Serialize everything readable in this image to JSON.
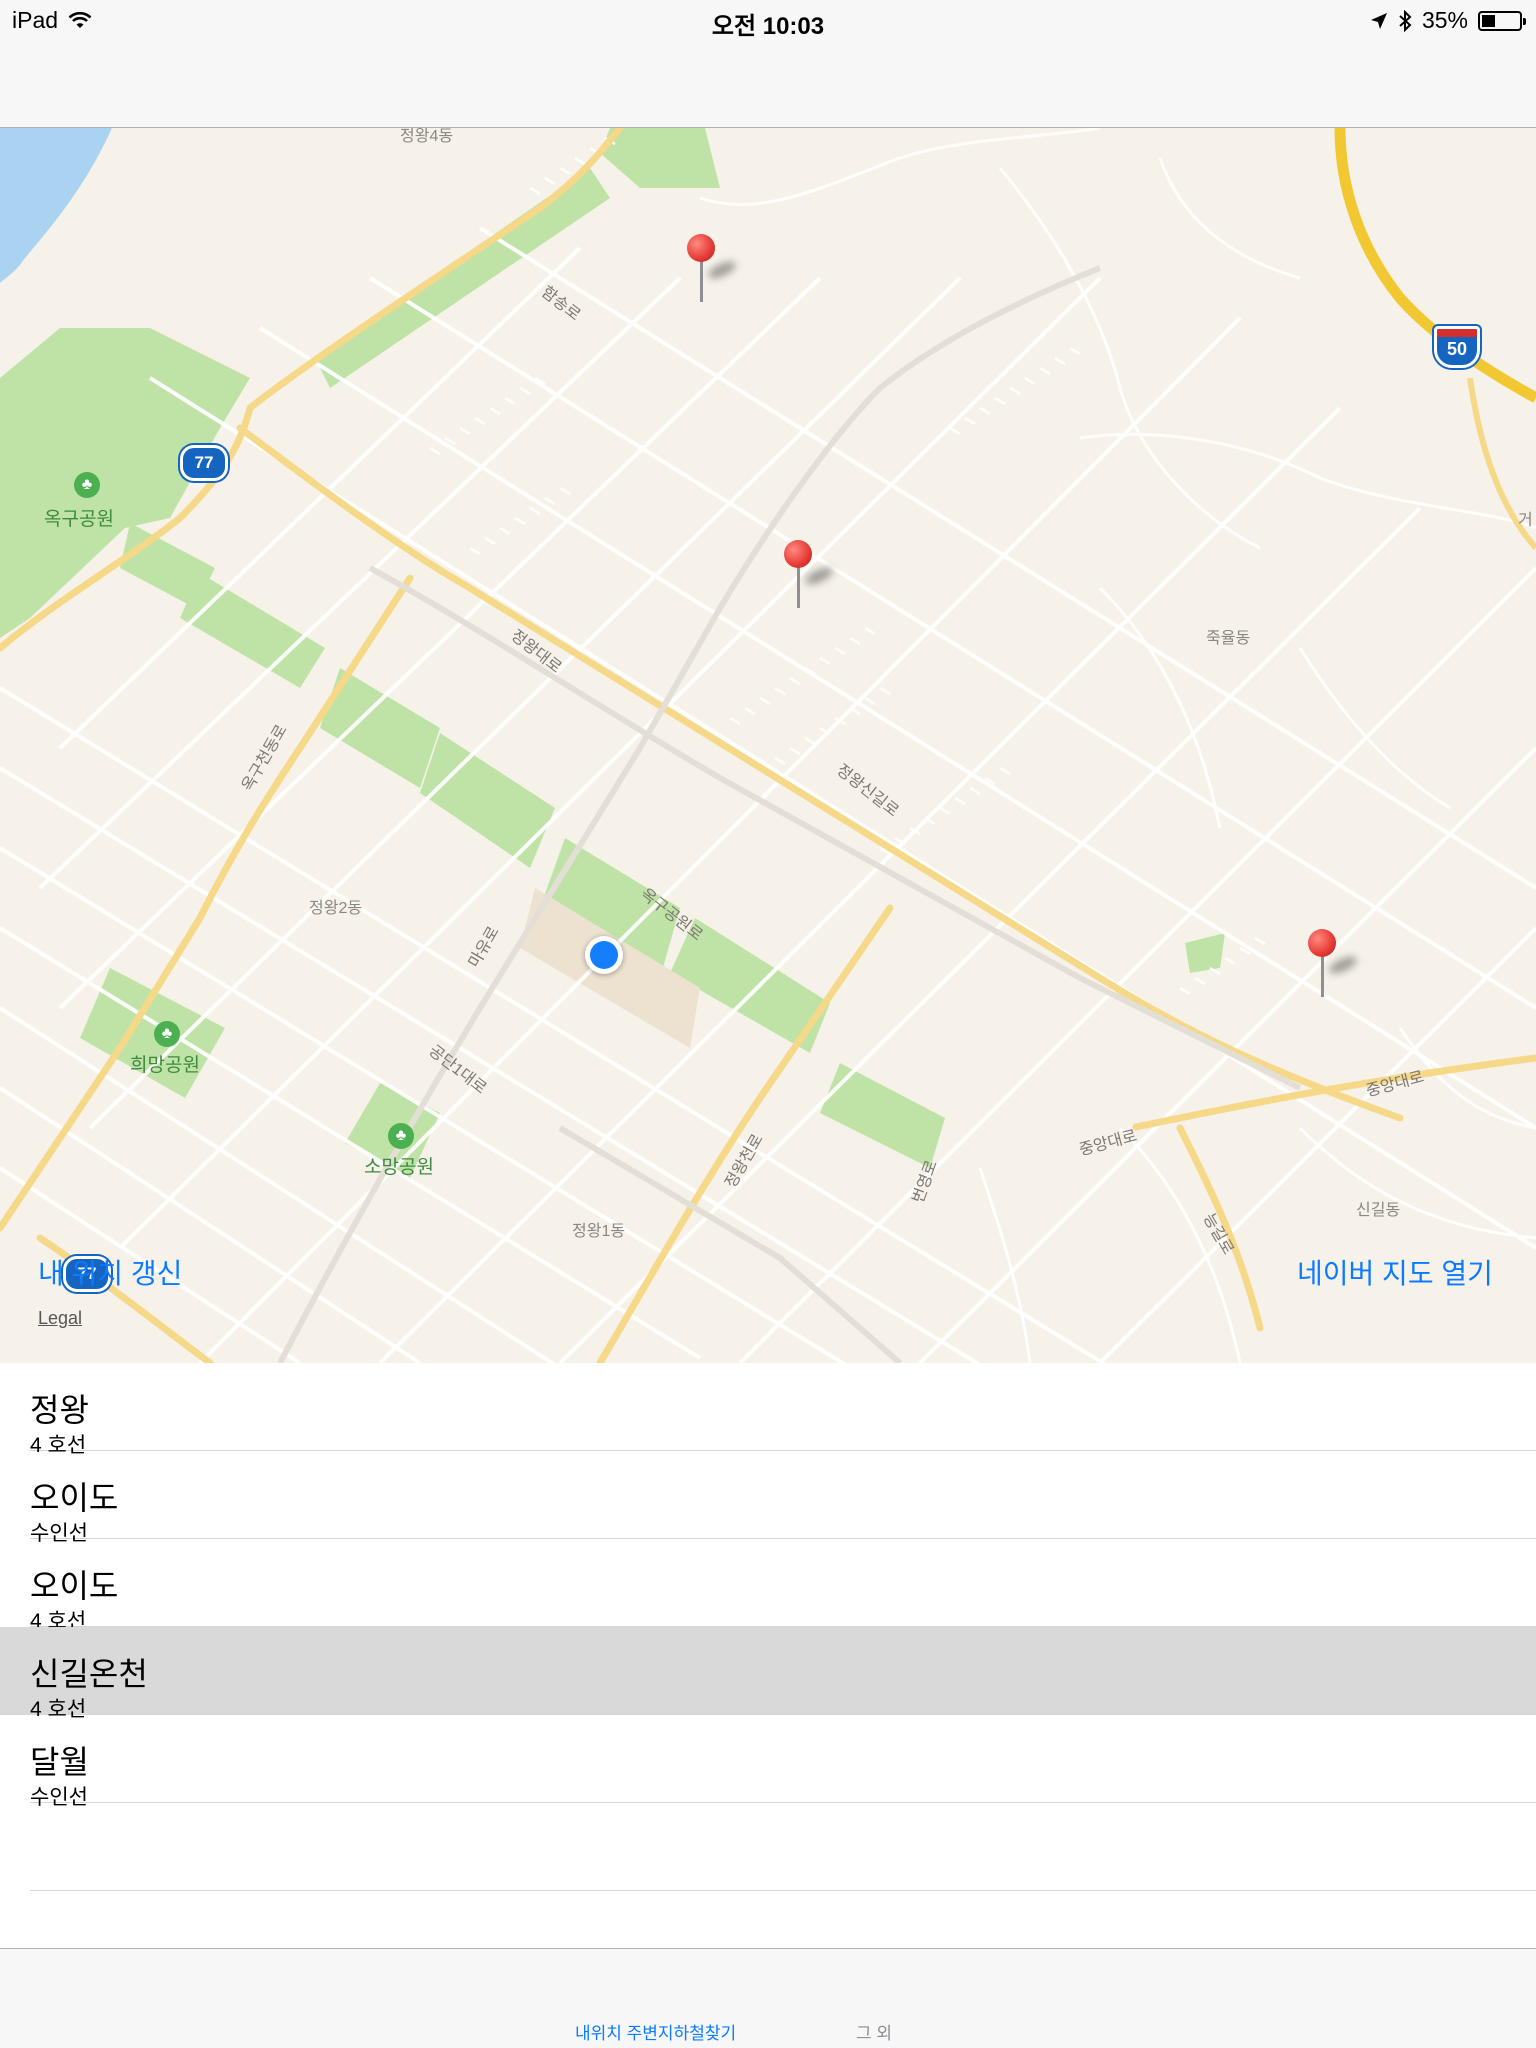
{
  "status_bar": {
    "device": "iPad",
    "time": "오전 10:03",
    "battery": "35%",
    "battery_level": 0.35
  },
  "map": {
    "labels": {
      "park_okgu": "옥구공원",
      "park_huimang": "희망공원",
      "park_somang": "소망공원",
      "dong_jeongwang2": "정왕2동",
      "dong_jeongwang1": "정왕1동",
      "dong_jukyul": "죽율동",
      "dong_singil": "신길동",
      "road_hamsong": "함송로",
      "road_jeongwang_daero": "정왕대로",
      "road_jeongwang_singil": "정왕신길로",
      "road_okgucheon_dong": "옥구천동로",
      "road_okgu_park": "옥구공원로",
      "road_mayu": "마유로",
      "road_gongdan1": "공단1대로",
      "road_jeongwang_cheon": "정왕천로",
      "road_beonyeong": "번영로",
      "road_jungang_1": "중앙대로",
      "road_jungang_2": "중앙대로",
      "road_neunggil": "능길로",
      "road_top_partial": "정왕4동",
      "road_edge_partial": "거"
    },
    "shields": {
      "route_77_top": "77",
      "route_77_bottom": "77",
      "route_50": "50"
    },
    "update_location_label": "내 위치 갱신",
    "open_naver_map_label": "네이버 지도 열기",
    "legal_label": "Legal"
  },
  "stations": [
    {
      "name": "정왕",
      "line": "4 호선",
      "selected": false
    },
    {
      "name": "오이도",
      "line": "수인선",
      "selected": false
    },
    {
      "name": "오이도",
      "line": "4 호선",
      "selected": false
    },
    {
      "name": "신길온천",
      "line": "4 호선",
      "selected": true
    },
    {
      "name": "달월",
      "line": "수인선",
      "selected": false
    }
  ],
  "tab_bar": {
    "tab_nearby": "내위치 주변지하철찾기",
    "tab_other": "그 외"
  },
  "colors": {
    "accent": "#0a7aff",
    "map_background": "#f6f2ea",
    "park": "#bfe3a7",
    "water": "#a9d3f0",
    "arterial": "#f6d889",
    "highway": "#f2c832",
    "pin": "#e53935",
    "selected_row": "#d9d9d9"
  }
}
